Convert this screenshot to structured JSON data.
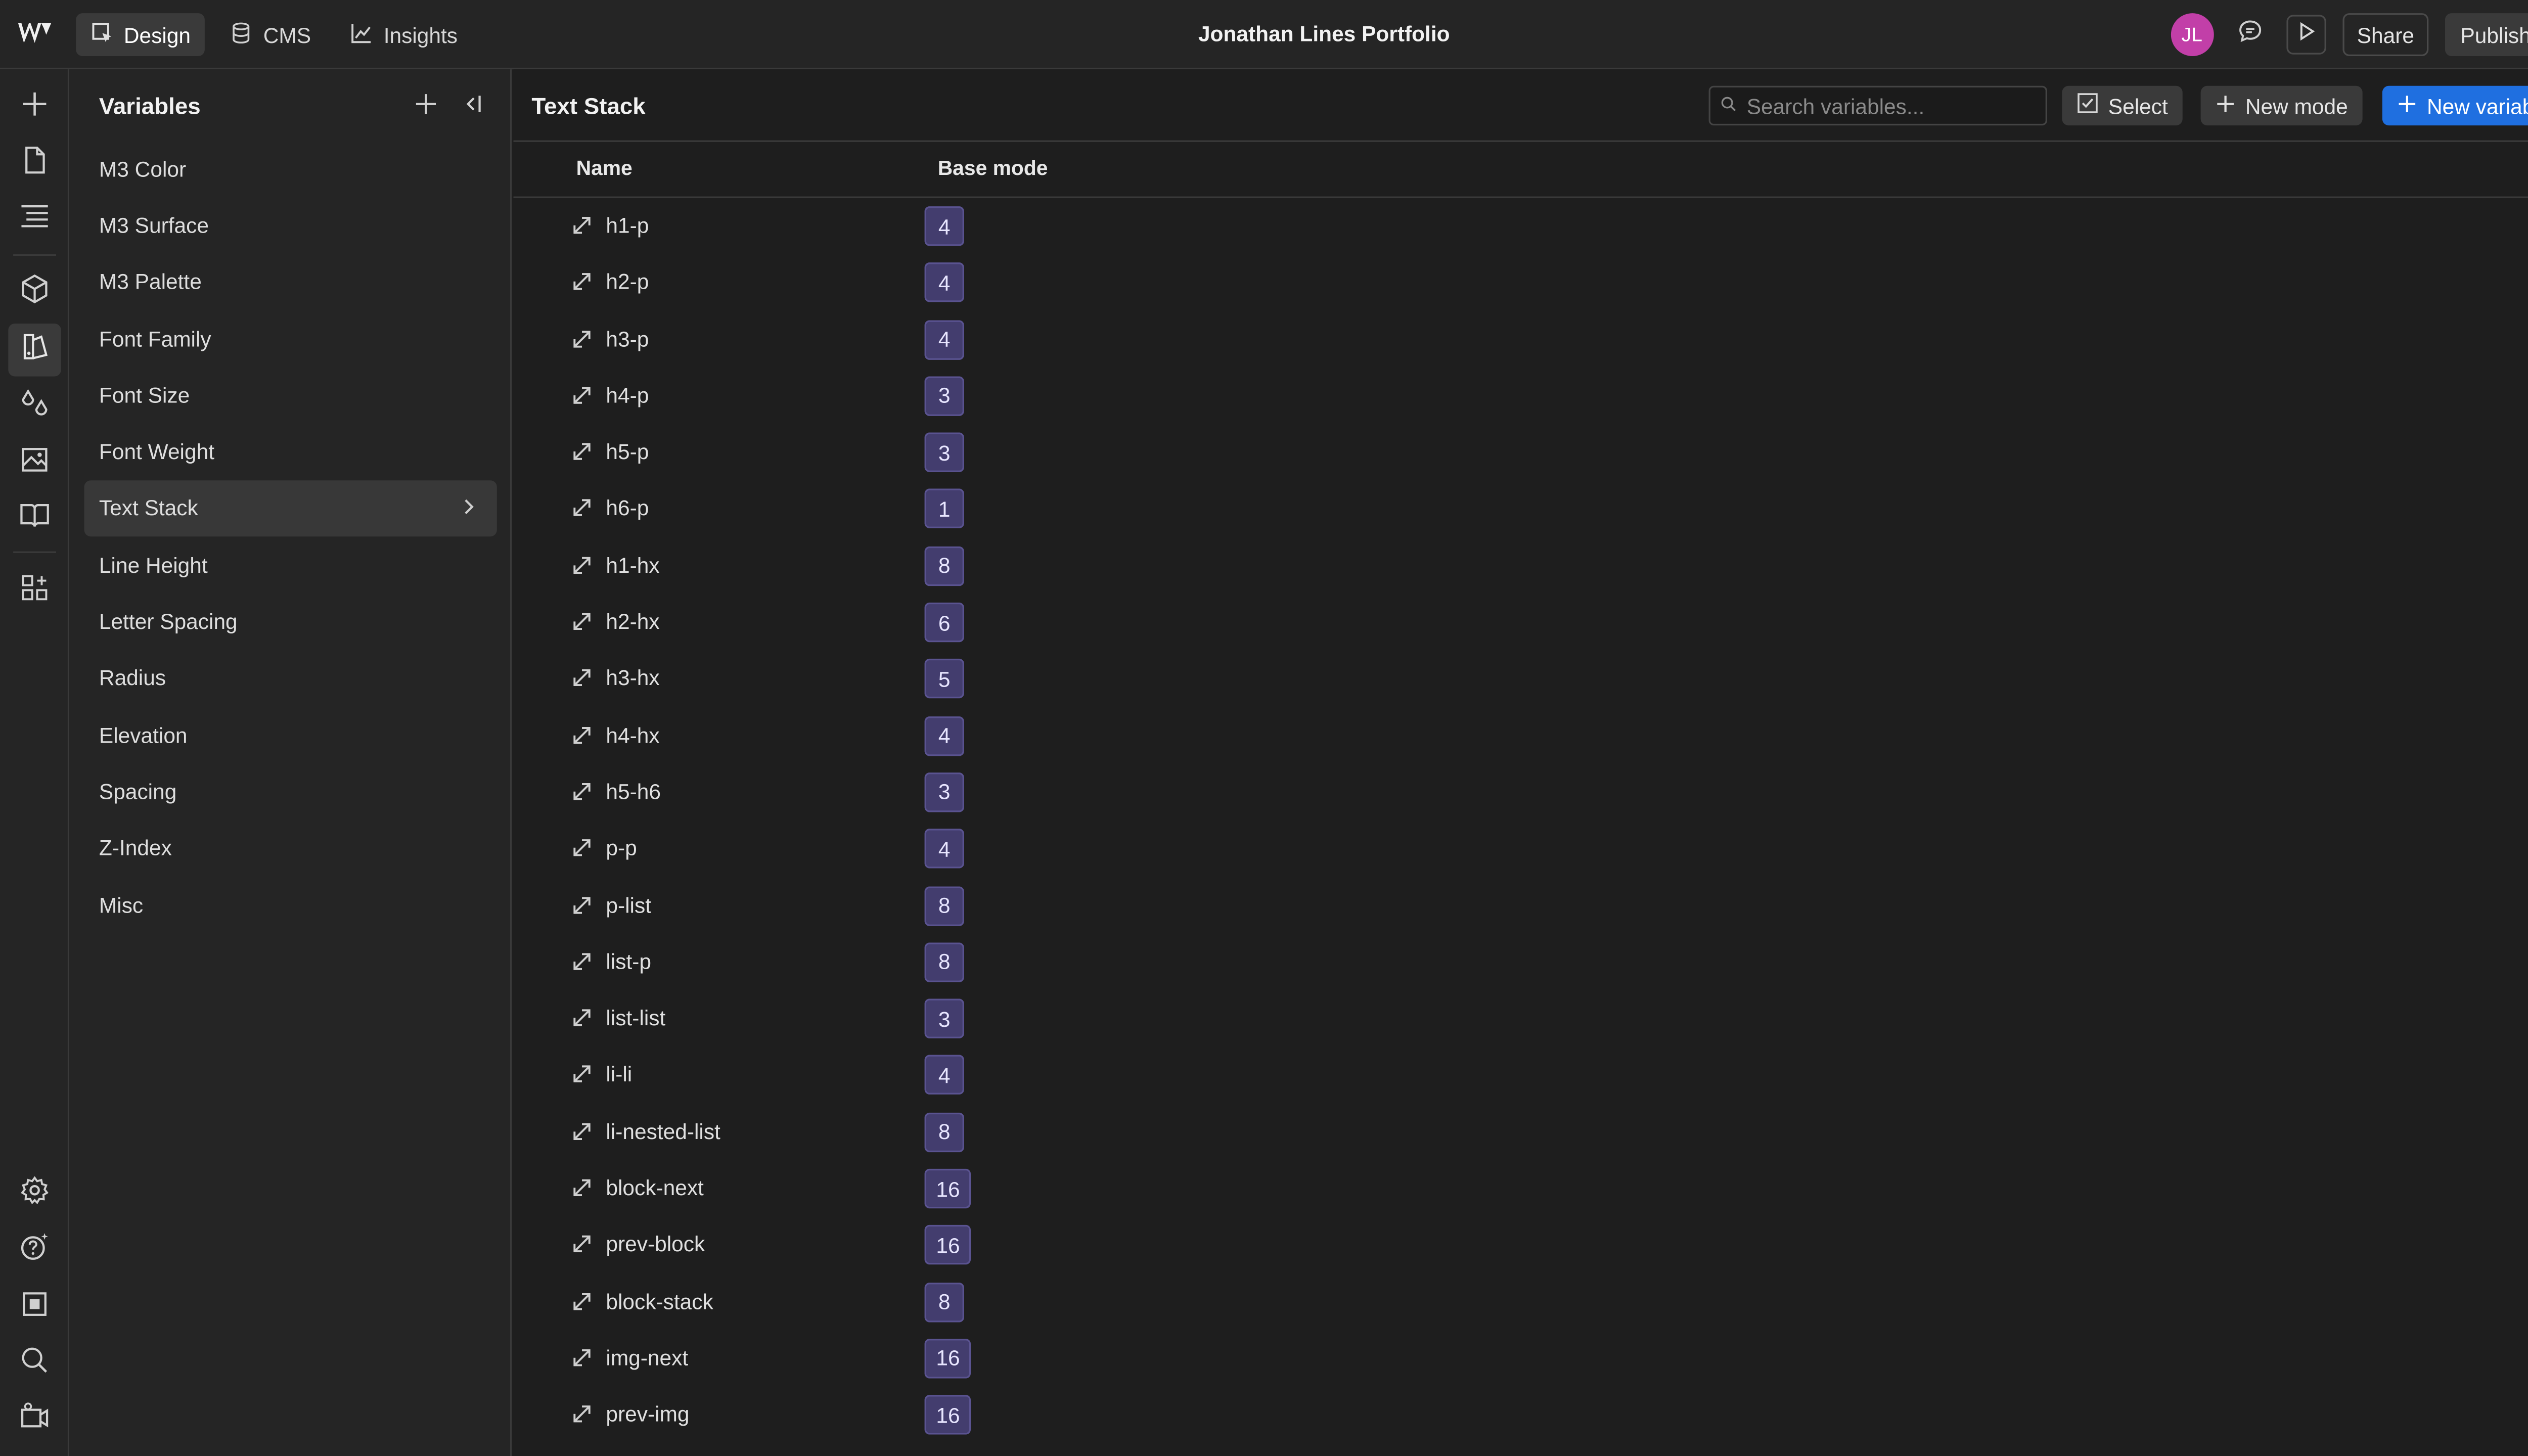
{
  "topbar": {
    "nav": [
      {
        "label": "Design",
        "icon": "design-icon",
        "active": true
      },
      {
        "label": "CMS",
        "icon": "database-icon",
        "active": false
      },
      {
        "label": "Insights",
        "icon": "chart-icon",
        "active": false
      }
    ],
    "title": "Jonathan Lines Portfolio",
    "avatar_initials": "JL",
    "avatar_color": "#c23fa8",
    "share_label": "Share",
    "publish_label": "Publish"
  },
  "variables_panel": {
    "title": "Variables",
    "collections": [
      {
        "label": "M3 Color"
      },
      {
        "label": "M3 Surface"
      },
      {
        "label": "M3 Palette"
      },
      {
        "label": "Font Family"
      },
      {
        "label": "Font Size"
      },
      {
        "label": "Font Weight"
      },
      {
        "label": "Text Stack",
        "active": true
      },
      {
        "label": "Line Height"
      },
      {
        "label": "Letter Spacing"
      },
      {
        "label": "Radius"
      },
      {
        "label": "Elevation"
      },
      {
        "label": "Spacing"
      },
      {
        "label": "Z-Index"
      },
      {
        "label": "Misc"
      }
    ]
  },
  "main": {
    "title": "Text Stack",
    "search_placeholder": "Search variables...",
    "select_label": "Select",
    "new_mode_label": "New mode",
    "new_variable_label": "New variable",
    "accent_color": "#1f6fe0",
    "columns": {
      "name": "Name",
      "base_mode": "Base mode"
    },
    "rows": [
      {
        "name": "h1-p",
        "value": "4"
      },
      {
        "name": "h2-p",
        "value": "4"
      },
      {
        "name": "h3-p",
        "value": "4"
      },
      {
        "name": "h4-p",
        "value": "3"
      },
      {
        "name": "h5-p",
        "value": "3"
      },
      {
        "name": "h6-p",
        "value": "1"
      },
      {
        "name": "h1-hx",
        "value": "8"
      },
      {
        "name": "h2-hx",
        "value": "6"
      },
      {
        "name": "h3-hx",
        "value": "5"
      },
      {
        "name": "h4-hx",
        "value": "4"
      },
      {
        "name": "h5-h6",
        "value": "3"
      },
      {
        "name": "p-p",
        "value": "4"
      },
      {
        "name": "p-list",
        "value": "8"
      },
      {
        "name": "list-p",
        "value": "8"
      },
      {
        "name": "list-list",
        "value": "3"
      },
      {
        "name": "li-li",
        "value": "4"
      },
      {
        "name": "li-nested-list",
        "value": "8"
      },
      {
        "name": "block-next",
        "value": "16"
      },
      {
        "name": "prev-block",
        "value": "16"
      },
      {
        "name": "block-stack",
        "value": "8"
      },
      {
        "name": "img-next",
        "value": "16"
      },
      {
        "name": "prev-img",
        "value": "16"
      }
    ]
  }
}
